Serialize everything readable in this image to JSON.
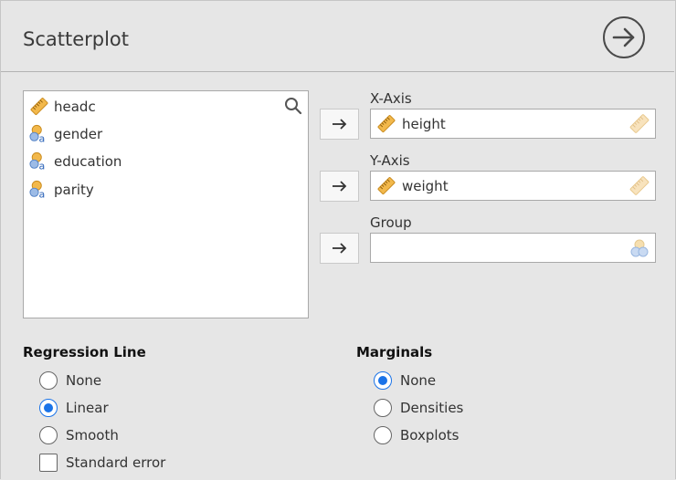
{
  "panel": {
    "title": "Scatterplot"
  },
  "variables": [
    {
      "name": "headc",
      "icon": "continuous-icon"
    },
    {
      "name": "gender",
      "icon": "nominal-text-icon"
    },
    {
      "name": "education",
      "icon": "nominal-text-icon"
    },
    {
      "name": "parity",
      "icon": "nominal-text-icon"
    }
  ],
  "targets": {
    "x_axis": {
      "label": "X-Axis",
      "value": "height"
    },
    "y_axis": {
      "label": "Y-Axis",
      "value": "weight"
    },
    "group": {
      "label": "Group",
      "value": ""
    }
  },
  "regression": {
    "title": "Regression Line",
    "options": [
      "None",
      "Linear",
      "Smooth"
    ],
    "selected": "Linear",
    "standard_error": {
      "label": "Standard error",
      "checked": false
    }
  },
  "marginals": {
    "title": "Marginals",
    "options": [
      "None",
      "Densities",
      "Boxplots"
    ],
    "selected": "None"
  },
  "colors": {
    "accent": "#1a73e8",
    "ruler": "#f0b43c",
    "nominal": "#5b8fd4"
  }
}
